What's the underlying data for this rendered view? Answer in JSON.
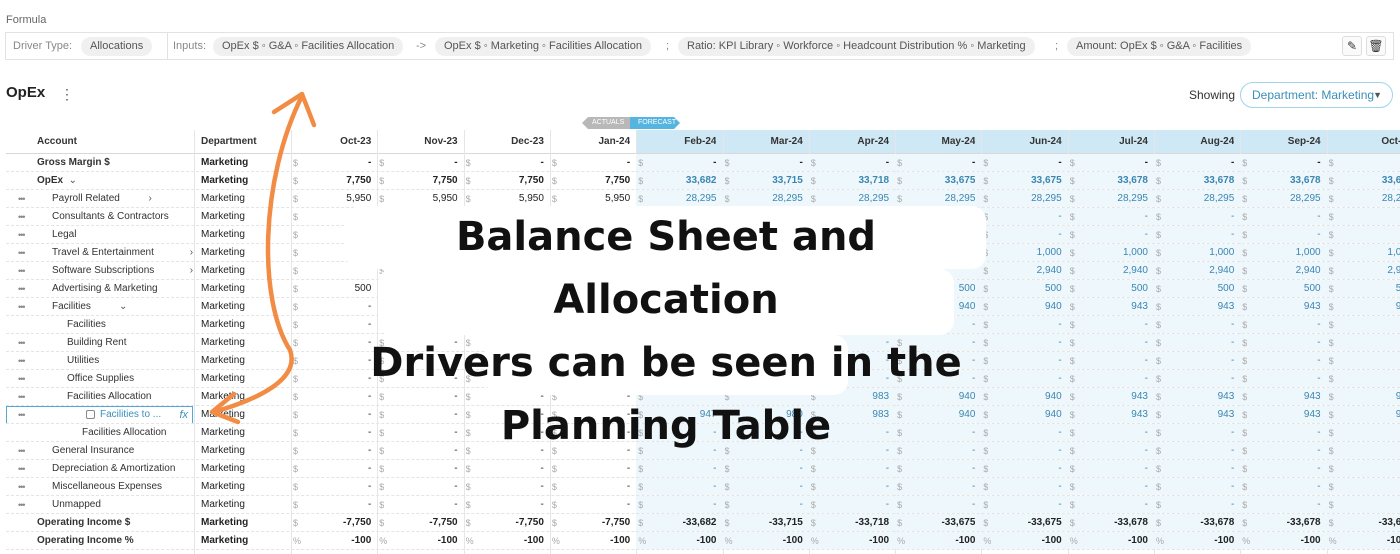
{
  "formula": {
    "section_label": "Formula",
    "driver_type_label": "Driver Type:",
    "driver_type_value": "Allocations",
    "inputs_label": "Inputs:",
    "input_1": "OpEx $ ◦ G&A ◦ Facilities Allocation",
    "arrow_op": "->",
    "input_2": "OpEx $ ◦ Marketing ◦ Facilities Allocation",
    "sep_1": ";",
    "input_3": "Ratio: KPI Library ◦ Workforce ◦ Headcount Distribution % ◦ Marketing",
    "sep_2": ";",
    "input_4": "Amount: OpEx $ ◦ G&A ◦ Facilities",
    "edit_icon": "pencil-icon",
    "delete_icon": "trash-icon"
  },
  "page": {
    "title": "OpEx",
    "menu_icon": "kebab-icon"
  },
  "filter": {
    "showing_label": "Showing",
    "department_value": "Department: Marketing"
  },
  "tags": {
    "actuals": "ACTUALS",
    "forecast": "FORECAST"
  },
  "table": {
    "col_account": "Account",
    "col_department": "Department",
    "months": [
      "Oct-23",
      "Nov-23",
      "Dec-23",
      "Jan-24",
      "Feb-24",
      "Mar-24",
      "Apr-24",
      "May-24",
      "Jun-24",
      "Jul-24",
      "Aug-24",
      "Sep-24",
      "Oct-2"
    ],
    "rows": [
      {
        "label": "Gross Margin $",
        "dept": "Marketing",
        "sym": "$",
        "values": [
          "-",
          "-",
          "-",
          "-",
          "-",
          "-",
          "-",
          "-",
          "-",
          "-",
          "-",
          "-",
          "-"
        ]
      },
      {
        "label": "OpEx",
        "chev": "⌄",
        "dept": "Marketing",
        "sym": "$",
        "values": [
          "7,750",
          "7,750",
          "7,750",
          "7,750",
          "33,682",
          "33,715",
          "33,718",
          "33,675",
          "33,675",
          "33,678",
          "33,678",
          "33,678",
          "33,63"
        ]
      },
      {
        "label": "Payroll Related",
        "chev": "›",
        "dept": "Marketing",
        "sym": "$",
        "values": [
          "5,950",
          "5,950",
          "5,950",
          "5,950",
          "28,295",
          "28,295",
          "28,295",
          "28,295",
          "28,295",
          "28,295",
          "28,295",
          "28,295",
          "28,29"
        ]
      },
      {
        "label": "Consultants & Contractors",
        "dept": "Marketing",
        "sym": "$",
        "values": [
          "",
          "",
          "",
          "",
          "",
          "",
          "",
          "",
          "-",
          "-",
          "-",
          "-",
          "-"
        ]
      },
      {
        "label": "Legal",
        "dept": "Marketing",
        "sym": "$",
        "values": [
          "",
          "",
          "",
          "",
          "",
          "",
          "",
          "",
          "-",
          "-",
          "-",
          "-",
          "-"
        ]
      },
      {
        "label": "Travel & Entertainment",
        "chev": "›",
        "dept": "Marketing",
        "sym": "$",
        "values": [
          "",
          "",
          "",
          "",
          "",
          "",
          "",
          "",
          "1,000",
          "1,000",
          "1,000",
          "1,000",
          "1,00"
        ]
      },
      {
        "label": "Software Subscriptions",
        "chev": "›",
        "dept": "Marketing",
        "sym": "$",
        "values": [
          "",
          "",
          "",
          "",
          "",
          "",
          "",
          "",
          "2,940",
          "2,940",
          "2,940",
          "2,940",
          "2,94"
        ]
      },
      {
        "label": "Advertising & Marketing",
        "chev": "›",
        "dept": "Marketing",
        "sym": "$",
        "values": [
          "500",
          "",
          "",
          "",
          "",
          "",
          "",
          "500",
          "500",
          "500",
          "500",
          "500",
          "50"
        ]
      },
      {
        "label": "Facilities",
        "chev": "⌄",
        "dept": "Marketing",
        "sym": "$",
        "values": [
          "-",
          "",
          "",
          "",
          "",
          "",
          "",
          "940",
          "940",
          "943",
          "943",
          "943",
          "90"
        ]
      },
      {
        "label": "Facilities",
        "dept": "Marketing",
        "sym": "$",
        "values": [
          "-",
          "",
          "",
          "",
          "",
          "",
          "",
          "-",
          "-",
          "-",
          "-",
          "-",
          "-"
        ]
      },
      {
        "label": "Building Rent",
        "dept": "Marketing",
        "sym": "$",
        "values": [
          "-",
          "-",
          "",
          "",
          "",
          "",
          "-",
          "-",
          "-",
          "-",
          "-",
          "-",
          "-"
        ]
      },
      {
        "label": "Utilities",
        "dept": "Marketing",
        "sym": "$",
        "values": [
          "-",
          "-",
          "",
          "",
          "",
          "",
          "-",
          "-",
          "-",
          "-",
          "-",
          "-",
          "-"
        ]
      },
      {
        "label": "Office Supplies",
        "dept": "Marketing",
        "sym": "$",
        "values": [
          "-",
          "-",
          "",
          "",
          "",
          "",
          "-",
          "-",
          "-",
          "-",
          "-",
          "-",
          "-"
        ]
      },
      {
        "label": "Facilities Allocation",
        "chev": "⌄",
        "dept": "Marketing",
        "sym": "$",
        "values": [
          "-",
          "-",
          "-",
          "-",
          "",
          "",
          "983",
          "940",
          "940",
          "943",
          "943",
          "943",
          "90"
        ]
      },
      {
        "label": "Facilities to ...",
        "dept": "Marketing",
        "sym": "$",
        "fx": "fx",
        "values": [
          "-",
          "-",
          "-",
          "-",
          "947",
          "980",
          "983",
          "940",
          "940",
          "943",
          "943",
          "943",
          "90"
        ]
      },
      {
        "label": "Facilities Allocation",
        "dept": "Marketing",
        "sym": "$",
        "values": [
          "-",
          "-",
          "-",
          "-",
          "-",
          "-",
          "-",
          "-",
          "-",
          "-",
          "-",
          "-",
          "-"
        ]
      },
      {
        "label": "General Insurance",
        "dept": "Marketing",
        "sym": "$",
        "values": [
          "-",
          "-",
          "-",
          "-",
          "-",
          "-",
          "-",
          "-",
          "-",
          "-",
          "-",
          "-",
          "-"
        ]
      },
      {
        "label": "Depreciation & Amortization",
        "dept": "Marketing",
        "sym": "$",
        "values": [
          "-",
          "-",
          "-",
          "-",
          "-",
          "-",
          "-",
          "-",
          "-",
          "-",
          "-",
          "-",
          "-"
        ]
      },
      {
        "label": "Miscellaneous Expenses",
        "dept": "Marketing",
        "sym": "$",
        "values": [
          "-",
          "-",
          "-",
          "-",
          "-",
          "-",
          "-",
          "-",
          "-",
          "-",
          "-",
          "-",
          "-"
        ]
      },
      {
        "label": "Unmapped",
        "dept": "Marketing",
        "sym": "$",
        "values": [
          "-",
          "-",
          "-",
          "-",
          "-",
          "-",
          "-",
          "-",
          "-",
          "-",
          "-",
          "-",
          "-"
        ]
      },
      {
        "label": "Operating Income $",
        "dept": "Marketing",
        "sym": "$",
        "values": [
          "-7,750",
          "-7,750",
          "-7,750",
          "-7,750",
          "-33,682",
          "-33,715",
          "-33,718",
          "-33,675",
          "-33,675",
          "-33,678",
          "-33,678",
          "-33,678",
          "-33,63"
        ]
      },
      {
        "label": "Operating Income %",
        "dept": "Marketing",
        "sym": "%",
        "values": [
          "-100",
          "-100",
          "-100",
          "-100",
          "-100",
          "-100",
          "-100",
          "-100",
          "-100",
          "-100",
          "-100",
          "-100",
          "-100"
        ]
      }
    ]
  },
  "overlay": {
    "line_1": "Balance Sheet and Allocation",
    "line_2": "Drivers can be seen in the",
    "line_3": "Planning Table",
    "accent_color": "#f28c45"
  }
}
